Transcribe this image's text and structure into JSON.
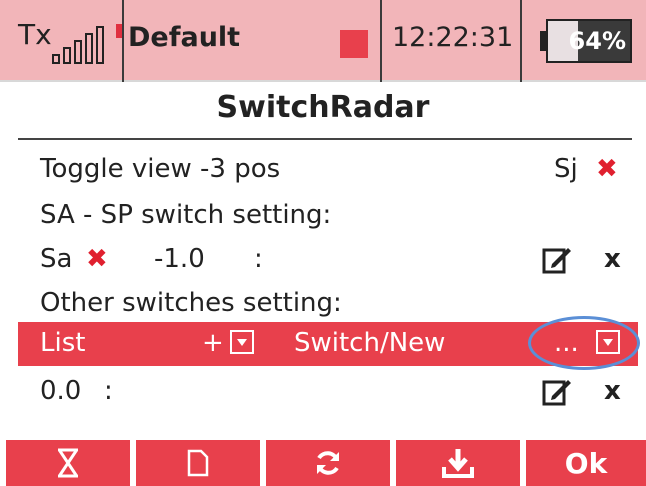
{
  "status_bar": {
    "tx_label": "Tx",
    "model_name": "Default",
    "clock": "12:22:31",
    "battery_percent_text": "64%",
    "battery_level": 0.64,
    "signal_bars": 5,
    "accent_color": "#e8404c",
    "bar_background": "#f2b5b9"
  },
  "title": "SwitchRadar",
  "rows": {
    "toggle_view": {
      "label": "Toggle view -3 pos",
      "switch": "Sj",
      "status_icon": "x-mark-icon"
    },
    "sa_sp_header": {
      "label": "SA - SP switch setting:"
    },
    "sa_entry": {
      "switch": "Sa",
      "value": "-1.0",
      "colon": ":",
      "delete": "x"
    },
    "other_header": {
      "label": "Other switches setting:"
    },
    "selected_row": {
      "list": "List",
      "plus": "+",
      "switch_new": "Switch/New",
      "more": "..."
    },
    "value_entry": {
      "value": "0.0",
      "colon": ":",
      "delete": "x"
    }
  },
  "toolbar": {
    "buttons": [
      {
        "icon": "hourglass-icon"
      },
      {
        "icon": "new-page-icon"
      },
      {
        "icon": "refresh-icon"
      },
      {
        "icon": "download-icon"
      },
      {
        "label": "Ok"
      }
    ]
  },
  "x_mark": "✖"
}
